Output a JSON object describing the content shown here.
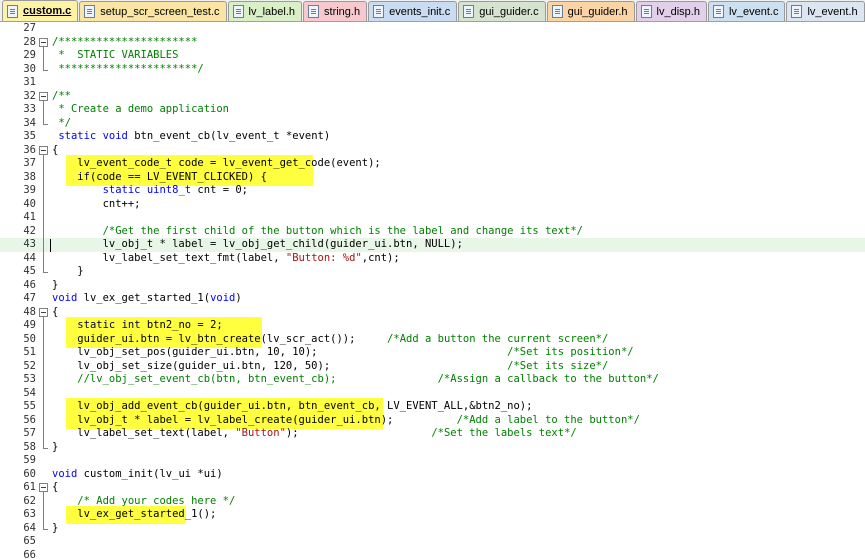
{
  "tabs": [
    {
      "label": "custom.c",
      "color": "#fdf3a6",
      "active": true
    },
    {
      "label": "setup_scr_screen_test.c",
      "color": "#fbe5a5",
      "active": false
    },
    {
      "label": "lv_label.h",
      "color": "#d9efc5",
      "active": false
    },
    {
      "label": "string.h",
      "color": "#f7c9cf",
      "active": false
    },
    {
      "label": "events_init.c",
      "color": "#c9dcf1",
      "active": false
    },
    {
      "label": "gui_guider.c",
      "color": "#d6e3cf",
      "active": false
    },
    {
      "label": "gui_guider.h",
      "color": "#fbd4a6",
      "active": false
    },
    {
      "label": "lv_disp.h",
      "color": "#e2d0ea",
      "active": false
    },
    {
      "label": "lv_event.c",
      "color": "#cde0f0",
      "active": false
    },
    {
      "label": "lv_event.h",
      "color": "#dce6f2",
      "active": false
    }
  ],
  "editor": {
    "current_line": 43,
    "lines": [
      {
        "n": "27",
        "t": ""
      },
      {
        "n": "28",
        "t": "/**********************"
      },
      {
        "n": "29",
        "t": " *  STATIC VARIABLES"
      },
      {
        "n": "30",
        "t": " **********************/"
      },
      {
        "n": "31",
        "t": ""
      },
      {
        "n": "32",
        "t": "/**"
      },
      {
        "n": "33",
        "t": " * Create a demo application"
      },
      {
        "n": "34",
        "t": " */"
      },
      {
        "n": "35",
        "t": " static void btn_event_cb(lv_event_t *event)"
      },
      {
        "n": "36",
        "t": "{"
      },
      {
        "n": "37",
        "t": "    lv_event_code_t code = lv_event_get_code(event);"
      },
      {
        "n": "38",
        "t": "    if(code == LV_EVENT_CLICKED) {"
      },
      {
        "n": "39",
        "t": "        static uint8_t cnt = 0;"
      },
      {
        "n": "40",
        "t": "        cnt++;"
      },
      {
        "n": "41",
        "t": ""
      },
      {
        "n": "42",
        "t": "        /*Get the first child of the button which is the label and change its text*/"
      },
      {
        "n": "43",
        "t": "        lv_obj_t * label = lv_obj_get_child(guider_ui.btn, NULL);"
      },
      {
        "n": "44",
        "t": "        lv_label_set_text_fmt(label, \"Button: %d\",cnt);"
      },
      {
        "n": "45",
        "t": "    }"
      },
      {
        "n": "46",
        "t": "}"
      },
      {
        "n": "47",
        "t": "void lv_ex_get_started_1(void)"
      },
      {
        "n": "48",
        "t": "{"
      },
      {
        "n": "49",
        "t": "    static int btn2_no = 2;"
      },
      {
        "n": "50",
        "t": "    guider_ui.btn = lv_btn_create(lv_scr_act());     /*Add a button the current screen*/"
      },
      {
        "n": "51",
        "t": "    lv_obj_set_pos(guider_ui.btn, 10, 10);                              /*Set its position*/"
      },
      {
        "n": "52",
        "t": "    lv_obj_set_size(guider_ui.btn, 120, 50);                            /*Set its size*/"
      },
      {
        "n": "53",
        "t": "    //lv_obj_set_event_cb(btn, btn_event_cb);                /*Assign a callback to the button*/"
      },
      {
        "n": "54",
        "t": ""
      },
      {
        "n": "55",
        "t": "    lv_obj_add_event_cb(guider_ui.btn, btn_event_cb, LV_EVENT_ALL,&btn2_no);"
      },
      {
        "n": "56",
        "t": "    lv_obj_t * label = lv_label_create(guider_ui.btn);          /*Add a label to the button*/"
      },
      {
        "n": "57",
        "t": "    lv_label_set_text(label, \"Button\");                     /*Set the labels text*/"
      },
      {
        "n": "58",
        "t": "}"
      },
      {
        "n": "59",
        "t": ""
      },
      {
        "n": "60",
        "t": "void custom_init(lv_ui *ui)"
      },
      {
        "n": "61",
        "t": "{"
      },
      {
        "n": "62",
        "t": "    /* Add your codes here */"
      },
      {
        "n": "63",
        "t": "    lv_ex_get_started_1();"
      },
      {
        "n": "64",
        "t": "}"
      },
      {
        "n": "65",
        "t": ""
      },
      {
        "n": "66",
        "t": ""
      }
    ]
  },
  "colors": {
    "keyword": "#0000ff",
    "comment": "#008000",
    "string": "#a31515",
    "current_line": "#e7f6e7",
    "highlight": "#ffff00"
  }
}
